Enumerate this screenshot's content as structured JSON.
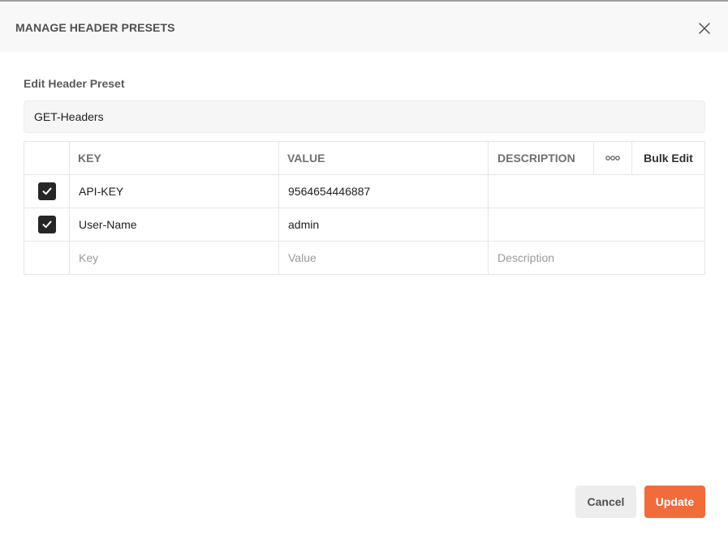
{
  "dialog": {
    "title": "MANAGE HEADER PRESETS",
    "close_icon": "close-icon"
  },
  "form": {
    "section_label": "Edit Header Preset",
    "preset_name": "GET-Headers"
  },
  "table": {
    "columns": {
      "key": "KEY",
      "value": "VALUE",
      "description": "DESCRIPTION",
      "more_icon": "more-options-icon",
      "bulk_edit": "Bulk Edit"
    },
    "rows": [
      {
        "checked": true,
        "key": "API-KEY",
        "value": "9564654446887",
        "description": ""
      },
      {
        "checked": true,
        "key": "User-Name",
        "value": "admin",
        "description": ""
      }
    ],
    "new_row": {
      "key_placeholder": "Key",
      "value_placeholder": "Value",
      "description_placeholder": "Description"
    }
  },
  "footer": {
    "cancel_label": "Cancel",
    "update_label": "Update"
  },
  "colors": {
    "accent": "#f26b3a",
    "checkbox": "#262626",
    "header_bg": "#f8f8f8"
  }
}
